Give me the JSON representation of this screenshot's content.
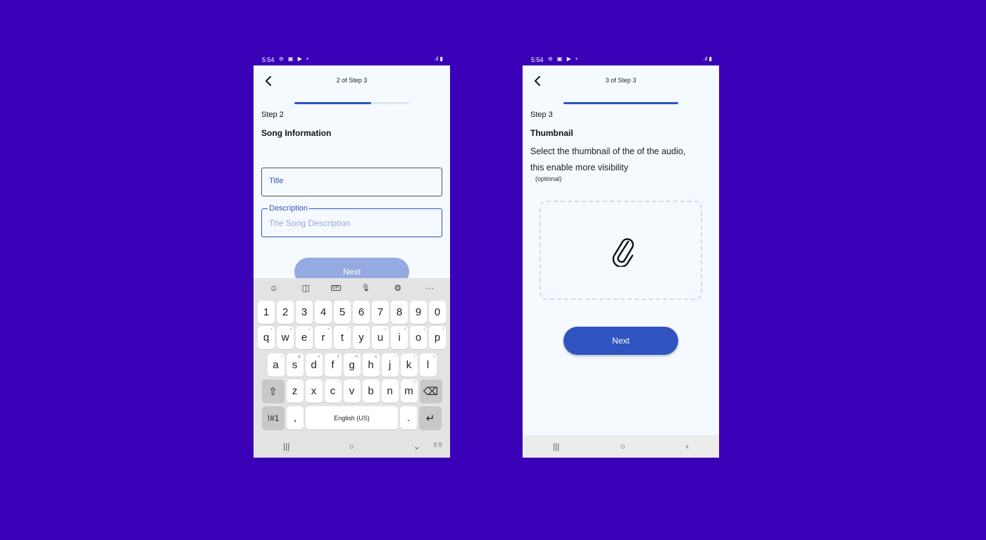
{
  "left_phone": {
    "status": {
      "time": "5:54",
      "icons": "⊖ ▣ ▶ •",
      "right": ".ıl ▮"
    },
    "header": {
      "title": "2 of Step 3"
    },
    "progress": {
      "fraction": 0.67
    },
    "step_label": "Step 2",
    "section_title": "Song Information",
    "title_field": {
      "label": "Title"
    },
    "description_field": {
      "label": "Description",
      "placeholder": "The Song Description"
    },
    "next_label": "Next",
    "keyboard": {
      "toolbar": [
        "☺",
        "◫",
        "GIF",
        "🎙",
        "⚙",
        "···"
      ],
      "row_numbers": [
        "1",
        "2",
        "3",
        "4",
        "5",
        "6",
        "7",
        "8",
        "9",
        "0"
      ],
      "row_q": [
        "q",
        "w",
        "e",
        "r",
        "t",
        "y",
        "u",
        "i",
        "o",
        "p"
      ],
      "row_q_sup": [
        "+",
        "×",
        "÷",
        "=",
        "/",
        "_",
        "<",
        ">",
        "[",
        "]"
      ],
      "row_a": [
        "a",
        "s",
        "d",
        "f",
        "g",
        "h",
        "j",
        "k",
        "l"
      ],
      "row_a_sup": [
        "!",
        "@",
        "#",
        "$",
        "%",
        "&",
        "*",
        "(",
        ")"
      ],
      "row_z": [
        "z",
        "x",
        "c",
        "v",
        "b",
        "n",
        "m"
      ],
      "row_z_sup": [
        "-",
        "'",
        "\"",
        ":",
        ";",
        ",",
        "?"
      ],
      "shift": "⇧",
      "backspace": "⌫",
      "symbols": "!#1",
      "comma": ",",
      "space": "English (US)",
      "period": ".",
      "enter": "↵"
    },
    "navbar": {
      "recent": "|||",
      "home": "○",
      "back": "⌄",
      "keyboard": "⠿⠿"
    }
  },
  "right_phone": {
    "status": {
      "time": "5:54",
      "icons": "⊖ ▣ ▶ •",
      "right": ".ıl ▮"
    },
    "header": {
      "title": "3 of Step 3"
    },
    "progress": {
      "fraction": 1.0
    },
    "step_label": "Step 3",
    "section_title": "Thumbnail",
    "description_line1": "Select the thumbnail of the of the audio,",
    "description_line2": "this enable more visibility",
    "optional": "(optional)",
    "next_label": "Next",
    "navbar": {
      "recent": "|||",
      "home": "○",
      "back": "‹"
    }
  },
  "colors": {
    "background": "#3a00b8",
    "accent": "#2f54c0",
    "accent_disabled": "#96aae2",
    "screen": "#f4faff"
  }
}
